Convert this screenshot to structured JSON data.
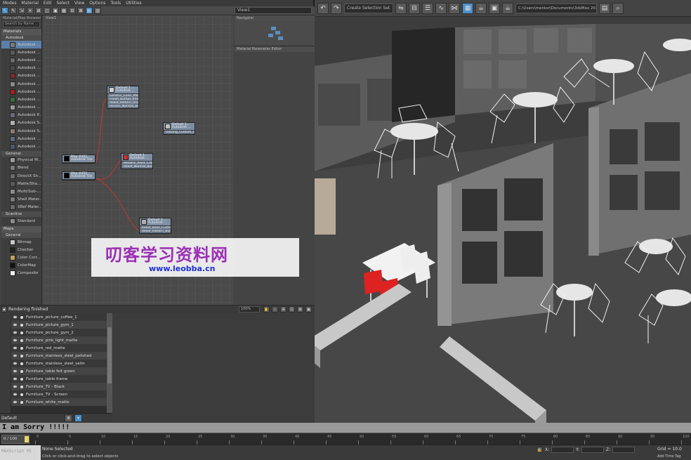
{
  "sme": {
    "menu": [
      "Modes",
      "Material",
      "Edit",
      "Select",
      "View",
      "Options",
      "Tools",
      "Utilities"
    ],
    "view_dropdown": "View1",
    "browser_title": "Material/Map Browser",
    "search_placeholder": "Search by Name ...",
    "view_label": "View1",
    "navigator_title": "Navigator",
    "params_title": "Material Parameter Editor",
    "status_text": "Rendering finished",
    "zoom": "100%",
    "sections": {
      "materials": "Materials",
      "autodesk": "Autodesk",
      "general": "General",
      "scanline": "Scanline",
      "maps": "Maps",
      "maps_general": "General"
    },
    "autodesk_items": [
      {
        "label": "Autodesk ...",
        "color": "#7a7a7a"
      },
      {
        "label": "Autodesk ...",
        "color": "#5a5a5a"
      },
      {
        "label": "Autodesk ...",
        "color": "#6a6a6a"
      },
      {
        "label": "Autodesk ...",
        "color": "#4a4a4a"
      },
      {
        "label": "Autodesk ...",
        "color": "#7a2a2a"
      },
      {
        "label": "Autodesk ...",
        "color": "#8a8a8a"
      },
      {
        "label": "Autodesk ...",
        "color": "#a02020"
      },
      {
        "label": "Autodesk ...",
        "color": "#3a6a3a"
      },
      {
        "label": "Autodesk ...",
        "color": "#9a9a9a"
      },
      {
        "label": "Autodesk P...",
        "color": "#6a6a7a"
      },
      {
        "label": "Autodesk S...",
        "color": "#b0b0b0"
      },
      {
        "label": "Autodesk S...",
        "color": "#8a7a6a"
      },
      {
        "label": "Autodesk ...",
        "color": "#5a6a7a"
      },
      {
        "label": "Autodesk ...",
        "color": "#4a5a6a"
      }
    ],
    "general_items": [
      {
        "label": "Physical M...",
        "color": "#9a9a9a"
      },
      {
        "label": "Blend",
        "color": "#7a7a7a"
      },
      {
        "label": "DirectX Sh...",
        "color": "#6a6a6a"
      },
      {
        "label": "Matte/Sha...",
        "color": "#5a5a5a"
      },
      {
        "label": "Multi/Sub-...",
        "color": "#8a8a8a"
      },
      {
        "label": "Shell Mater...",
        "color": "#7a7a7a"
      },
      {
        "label": "XRef Mater...",
        "color": "#6a6a6a"
      }
    ],
    "scanline_items": [
      {
        "label": "Standard",
        "color": "#8a8a8a"
      }
    ],
    "maps_items": [
      {
        "label": "Bitmap",
        "color": "#c8c8c8"
      },
      {
        "label": "Checker",
        "color": "#222222"
      },
      {
        "label": "Color Corr...",
        "color": "#c0a060"
      },
      {
        "label": "ColorMap",
        "color": "#111111"
      },
      {
        "label": "Composite",
        "color": "#eeeeee"
      }
    ],
    "nodes": [
      {
        "title": "Default 1 ...",
        "sub": "Autodesk ...",
        "preview": "#d0d0d0",
        "slots": [
          "Generic_Color_Map",
          "Finish_Bumps_Image",
          "Relief_Pattern_Image",
          "Recess_Normal_Bumps"
        ]
      },
      {
        "title": "Default 1...",
        "sub": "Autodesk ...",
        "preview": "#c0c0c0",
        "slots": [
          "Glazing_Custom_Colo..."
        ]
      },
      {
        "title": "Map #451",
        "sub": "Autodesk Tile",
        "preview": "#000000",
        "slots": []
      },
      {
        "title": "Default 1...",
        "sub": "Autodesk ...",
        "preview": "#c03030",
        "slots": [
          "Metallic_Paint_Color_Map",
          "Relief_Normal_Bumps"
        ]
      },
      {
        "title": "Map #452",
        "sub": "Autodesk Tile",
        "preview": "#000000",
        "slots": []
      },
      {
        "title": "Default 1...",
        "sub": "Autodesk ...",
        "preview": "#b0b0b0",
        "slots": [
          "Relief_Base_Custom_Co...",
          "Relief_Pattern_Bumps"
        ]
      }
    ]
  },
  "toolbar": {
    "selection_set": "Create Selection Set",
    "path": "C:\\Users\\mentor\\Documents\\3dsMax 2020"
  },
  "explorer": {
    "rows": [
      "Furniture_picture_coffee_1",
      "Furniture_picture_gym_1",
      "Furniture_picture_gym_2",
      "Furniture_pink_light_matte",
      "Furniture_red_matte",
      "Furniture_stainless_steel_polished",
      "Furniture_stainless_steel_satin",
      "Furniture_table felt green",
      "Furniture_table frame",
      "Furniture_TV - Black",
      "Furniture_TV - Screen",
      "Furniture_white_matte"
    ],
    "layer": "Default"
  },
  "overlay": {
    "sorry_text": "I am Sorry !!!!!"
  },
  "timeline": {
    "slider": "0 / 100",
    "ticks": [
      "0",
      "5",
      "10",
      "15",
      "20",
      "25",
      "30",
      "35",
      "40",
      "45",
      "50",
      "55",
      "60",
      "65",
      "70",
      "75",
      "80",
      "85",
      "90",
      "95",
      "100"
    ]
  },
  "statusbar": {
    "maxscript": "MAXScript Mi",
    "selection": "None Selected",
    "hint": "Click or click-and-drag to select objects",
    "x_label": "X:",
    "y_label": "Y:",
    "z_label": "Z:",
    "grid": "Grid = 10.0",
    "add_time_tag": "Add Time Tag"
  },
  "watermark": {
    "title": "叨客学习资料网",
    "url": "www.leobba.cn"
  }
}
